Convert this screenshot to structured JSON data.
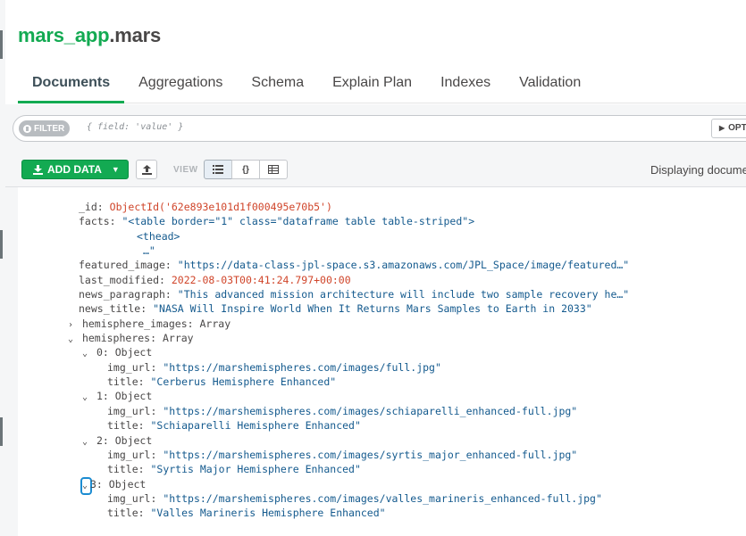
{
  "namespace": {
    "database": "mars_app",
    "collection": ".mars"
  },
  "tabs": [
    {
      "label": "Documents",
      "active": true
    },
    {
      "label": "Aggregations"
    },
    {
      "label": "Schema"
    },
    {
      "label": "Explain Plan"
    },
    {
      "label": "Indexes"
    },
    {
      "label": "Validation"
    }
  ],
  "filter": {
    "pill_label": "FILTER",
    "placeholder": "{ field: 'value' }",
    "options_label": "OPTIO"
  },
  "toolbar": {
    "add_data_label": "ADD DATA",
    "view_label": "VIEW",
    "view_buttons": [
      "list",
      "{}",
      "table"
    ],
    "displaying_text": "Displaying docume"
  },
  "document": {
    "id_key": "_id:",
    "id_value": "ObjectId('62e893e101d1f000495e70b5')",
    "facts_key": "facts:",
    "facts_line1": "\"<table border=\"1\" class=\"dataframe table table-striped\">",
    "facts_line2": "<thead>",
    "facts_line3": "…\"",
    "featured_image_key": "featured_image:",
    "featured_image_value": "\"https://data-class-jpl-space.s3.amazonaws.com/JPL_Space/image/featured…\"",
    "last_modified_key": "last_modified:",
    "last_modified_value": "2022-08-03T00:41:24.797+00:00",
    "news_paragraph_key": "news_paragraph:",
    "news_paragraph_value": "\"This advanced mission architecture will include two sample recovery he…\"",
    "news_title_key": "news_title:",
    "news_title_value": "\"NASA Will Inspire World When It Returns Mars Samples to Earth in 2033\"",
    "hemisphere_images_key": "hemisphere_images:",
    "hemisphere_images_type": "Array",
    "hemispheres_key": "hemispheres:",
    "hemispheres_type": "Array",
    "items": [
      {
        "index": "0:",
        "type": "Object",
        "img_url_key": "img_url:",
        "img_url": "\"https://marshemispheres.com/images/full.jpg\"",
        "title_key": "title:",
        "title": "\"Cerberus Hemisphere Enhanced\""
      },
      {
        "index": "1:",
        "type": "Object",
        "img_url_key": "img_url:",
        "img_url": "\"https://marshemispheres.com/images/schiaparelli_enhanced-full.jpg\"",
        "title_key": "title:",
        "title": "\"Schiaparelli Hemisphere Enhanced\""
      },
      {
        "index": "2:",
        "type": "Object",
        "img_url_key": "img_url:",
        "img_url": "\"https://marshemispheres.com/images/syrtis_major_enhanced-full.jpg\"",
        "title_key": "title:",
        "title": "\"Syrtis Major Hemisphere Enhanced\""
      },
      {
        "index": "3:",
        "type": "Object",
        "img_url_key": "img_url:",
        "img_url": "\"https://marshemispheres.com/images/valles_marineris_enhanced-full.jpg\"",
        "title_key": "title:",
        "title": "\"Valles Marineris Hemisphere Enhanced\""
      }
    ]
  },
  "colors": {
    "brand_green": "#13aa52",
    "string_blue": "#145a8e",
    "objectid_red": "#d0452a",
    "focus_blue": "#1c8cd1"
  }
}
